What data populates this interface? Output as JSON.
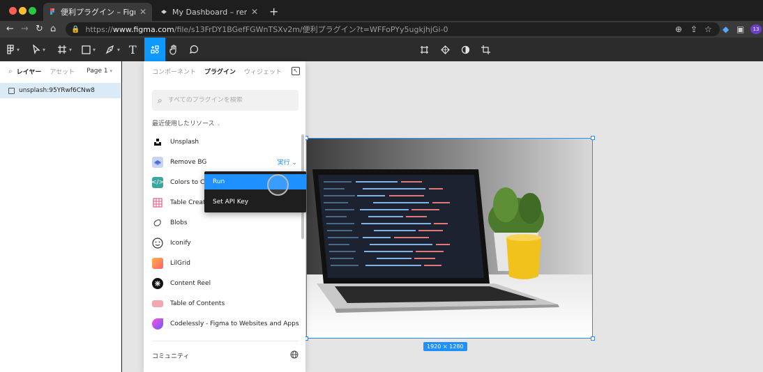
{
  "browser": {
    "tabs": [
      {
        "title": "便利プラグイン – Figma",
        "active": true
      },
      {
        "title": "My Dashboard – remove.bg",
        "active": false
      }
    ],
    "new_tab": "+",
    "url_prefix": "https://",
    "url_host": "www.figma.com",
    "url_path": "/file/s13FrDY1BGefFGWnTSXv2m/便利プラグイン?t=WFFoPYy5ugkjhjGi-0",
    "extension_badge": "13"
  },
  "toolbar": {
    "tools": [
      "main-menu",
      "move",
      "frame",
      "shape",
      "pen",
      "text",
      "resources",
      "hand",
      "comment"
    ],
    "text_tool_glyph": "T",
    "center_tools": [
      "component",
      "mask",
      "boolean",
      "crop"
    ]
  },
  "left_panel": {
    "tabs": {
      "layers": "レイヤー",
      "assets": "アセット"
    },
    "page": "Page 1",
    "layer_name": "unsplash:95YRwf6CNw8"
  },
  "plugins_panel": {
    "tabs": [
      "コンポーネント",
      "プラグイン",
      "ウィジェット"
    ],
    "active_tab": "プラグイン",
    "search_placeholder": "すべてのプラグインを検索",
    "section_title": "最近使用したリソース",
    "items": [
      {
        "name": "Unsplash"
      },
      {
        "name": "Remove BG",
        "run_label": "実行"
      },
      {
        "name": "Colors to Code"
      },
      {
        "name": "Table Creator"
      },
      {
        "name": "Blobs"
      },
      {
        "name": "Iconify"
      },
      {
        "name": "LilGrid"
      },
      {
        "name": "Content Reel"
      },
      {
        "name": "Table of Contents"
      },
      {
        "name": "Codelessly - Figma to Websites and Apps ..."
      }
    ],
    "community_label": "コミュニティ"
  },
  "context_menu": {
    "items": [
      "Run",
      "Set API Key"
    ],
    "highlighted": "Run"
  },
  "canvas": {
    "selection_dimensions": "1920 × 1280"
  },
  "colors": {
    "accent": "#1e90ff",
    "figma_active_tool": "#0d99ff",
    "toolbar_bg": "#2c2c2c",
    "canvas_bg": "#e5e5e5"
  }
}
